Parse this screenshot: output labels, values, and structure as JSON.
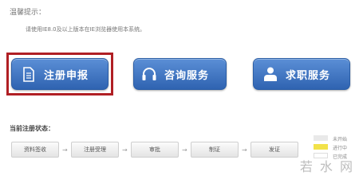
{
  "tips": {
    "title": "温馨提示：",
    "text": "请使用IE8.0及以上版本在IE浏览器使用本系统。"
  },
  "buttons": {
    "register": "注册申报",
    "consult": "咨询服务",
    "job": "求职服务"
  },
  "status": {
    "title": "当前注册状态：",
    "steps": [
      "资料签收",
      "注册受理",
      "审批",
      "制证",
      "发证"
    ]
  },
  "legend": [
    {
      "label": "未开始",
      "color": "#e9e9e9"
    },
    {
      "label": "进行中",
      "color": "#f2e24a"
    },
    {
      "label": "已完成",
      "color": "#ffffff"
    }
  ],
  "watermark": "若 水 网"
}
